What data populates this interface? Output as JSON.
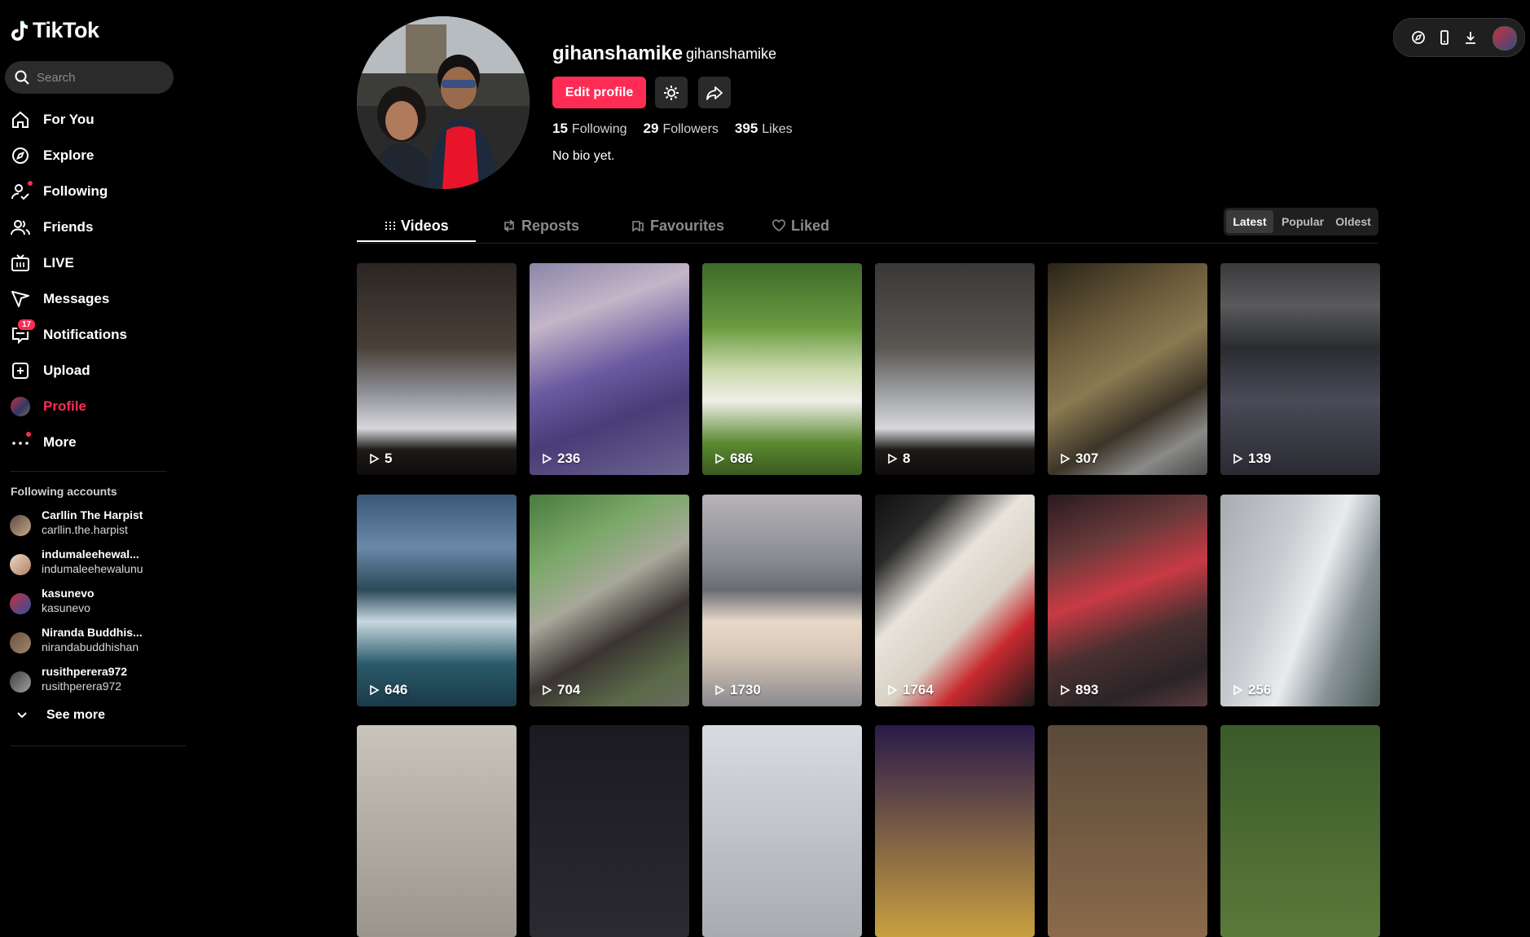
{
  "app": {
    "name": "TikTok"
  },
  "search": {
    "placeholder": "Search"
  },
  "nav": [
    {
      "label": "For You",
      "icon": "home-icon"
    },
    {
      "label": "Explore",
      "icon": "compass-icon"
    },
    {
      "label": "Following",
      "icon": "following-icon"
    },
    {
      "label": "Friends",
      "icon": "friends-icon"
    },
    {
      "label": "LIVE",
      "icon": "live-icon"
    },
    {
      "label": "Messages",
      "icon": "messages-icon"
    },
    {
      "label": "Notifications",
      "icon": "notifications-icon",
      "badge": "17"
    },
    {
      "label": "Upload",
      "icon": "upload-icon"
    },
    {
      "label": "Profile",
      "icon": "profile-avatar",
      "active": true
    },
    {
      "label": "More",
      "icon": "more-icon"
    }
  ],
  "following_accounts": {
    "title": "Following accounts",
    "items": [
      {
        "name": "Carllin The Harpist",
        "handle": "carllin.the.harpist"
      },
      {
        "name": "indumaleehewal...",
        "handle": "indumaleehewalunu"
      },
      {
        "name": "kasunevo",
        "handle": "kasunevo"
      },
      {
        "name": "Niranda Buddhis...",
        "handle": "nirandabuddhishan"
      },
      {
        "name": "rusithperera972",
        "handle": "rusithperera972"
      }
    ],
    "see_more": "See more"
  },
  "profile": {
    "username": "gihanshamike",
    "nickname": "gihanshamike",
    "edit_label": "Edit profile",
    "following_count": "15",
    "following_label": "Following",
    "followers_count": "29",
    "followers_label": "Followers",
    "likes_count": "395",
    "likes_label": "Likes",
    "bio": "No bio yet."
  },
  "tabs": [
    {
      "label": "Videos",
      "icon": "grid-icon",
      "active": true
    },
    {
      "label": "Reposts",
      "icon": "repost-icon"
    },
    {
      "label": "Favourites",
      "icon": "bookmark-icon"
    },
    {
      "label": "Liked",
      "icon": "heart-icon"
    }
  ],
  "sort": {
    "latest": "Latest",
    "popular": "Popular",
    "oldest": "Oldest"
  },
  "videos": [
    {
      "views": "5"
    },
    {
      "views": "236"
    },
    {
      "views": "686"
    },
    {
      "views": "8"
    },
    {
      "views": "307"
    },
    {
      "views": "139"
    },
    {
      "views": "646"
    },
    {
      "views": "704"
    },
    {
      "views": "1730"
    },
    {
      "views": "1764"
    },
    {
      "views": "893"
    },
    {
      "views": "256"
    }
  ],
  "colors": {
    "accent": "#fe2c55",
    "background": "#000000"
  }
}
